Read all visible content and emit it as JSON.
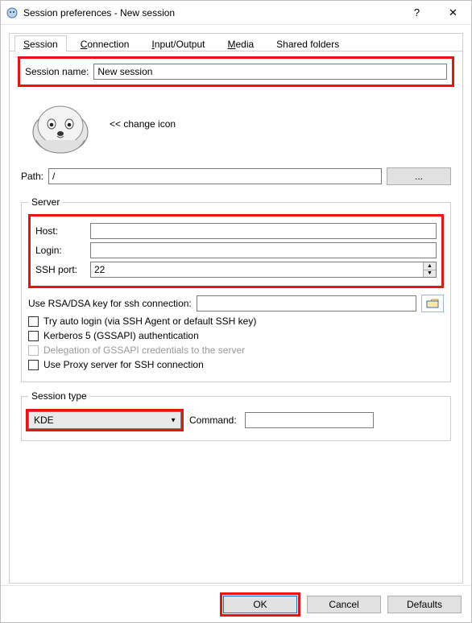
{
  "titlebar": {
    "title": "Session preferences - New session",
    "help": "?",
    "close": "✕"
  },
  "tabs": {
    "session": "Session",
    "connection": "Connection",
    "io": "Input/Output",
    "media": "Media",
    "shared": "Shared folders"
  },
  "session_tab": {
    "session_name_label": "Session name:",
    "session_name_value": "New session",
    "change_icon_text": "<< change icon",
    "path_label": "Path:",
    "path_value": "/",
    "browse_label": "...",
    "server": {
      "legend": "Server",
      "host_label": "Host:",
      "host_value": "",
      "login_label": "Login:",
      "login_value": "",
      "ssh_port_label": "SSH port:",
      "ssh_port_value": "22",
      "rsa_label": "Use RSA/DSA key for ssh connection:",
      "rsa_value": "",
      "auto_login": "Try auto login (via SSH Agent or default SSH key)",
      "kerberos": "Kerberos 5 (GSSAPI) authentication",
      "delegation": "Delegation of GSSAPI credentials to the server",
      "use_proxy": "Use Proxy server for SSH connection"
    },
    "session_type": {
      "legend": "Session type",
      "combo_value": "KDE",
      "command_label": "Command:",
      "command_value": ""
    }
  },
  "buttons": {
    "ok": "OK",
    "cancel": "Cancel",
    "defaults": "Defaults"
  }
}
